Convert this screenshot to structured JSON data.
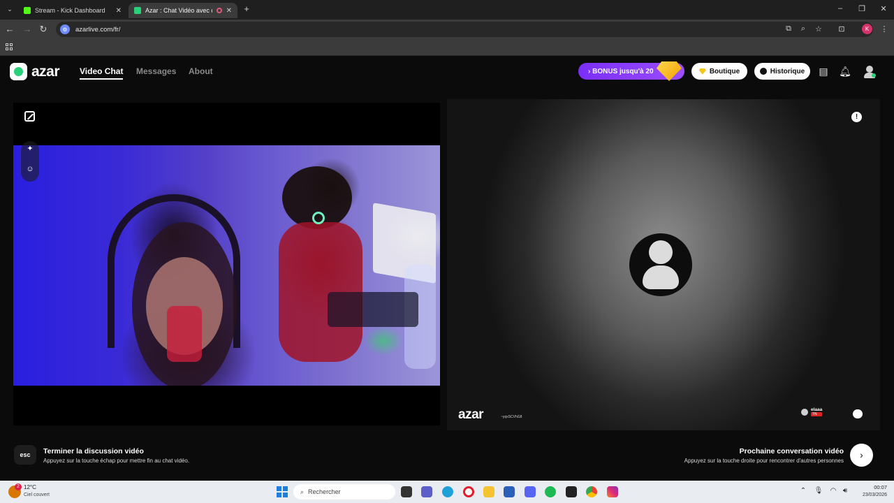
{
  "browser": {
    "tabs": [
      {
        "title": "Stream - Kick Dashboard",
        "active": false,
        "favicon_color": "#53fc18"
      },
      {
        "title": "Azar : Chat Vidéo avec de n",
        "active": true,
        "favicon_color": "#29d17b"
      }
    ],
    "url": "azarlive.com/fr/",
    "profile_initial": "K"
  },
  "header": {
    "logo_text": "azar",
    "nav": {
      "video_chat": "Video Chat",
      "messages": "Messages",
      "about": "About"
    },
    "bonus_label": "› BONUS jusqu'à 20",
    "boutique_label": "Boutique",
    "historique_label": "Historique"
  },
  "right_video": {
    "watermark": "azar",
    "watermark_id": "~yqxSCVhG8",
    "user_name": "elaaa",
    "user_country": "TN"
  },
  "bottom": {
    "esc_key": "esc",
    "end_title": "Terminer la discussion vidéo",
    "end_sub": "Appuyez sur la touche échap pour mettre fin au chat vidéo.",
    "next_title": "Prochaine conversation vidéo",
    "next_sub": "Appuyez sur la touche droite pour rencontrer d'autres personnes"
  },
  "taskbar": {
    "temperature": "12°C",
    "weather_desc": "Ciel couvert",
    "weather_badge": "2",
    "search_placeholder": "Rechercher",
    "time": "00:07",
    "date": "23/03/2026"
  },
  "colors": {
    "brand_green": "#29d17b",
    "bonus_purple": "#8b3dff",
    "browser_dark": "#3b3b3b"
  }
}
